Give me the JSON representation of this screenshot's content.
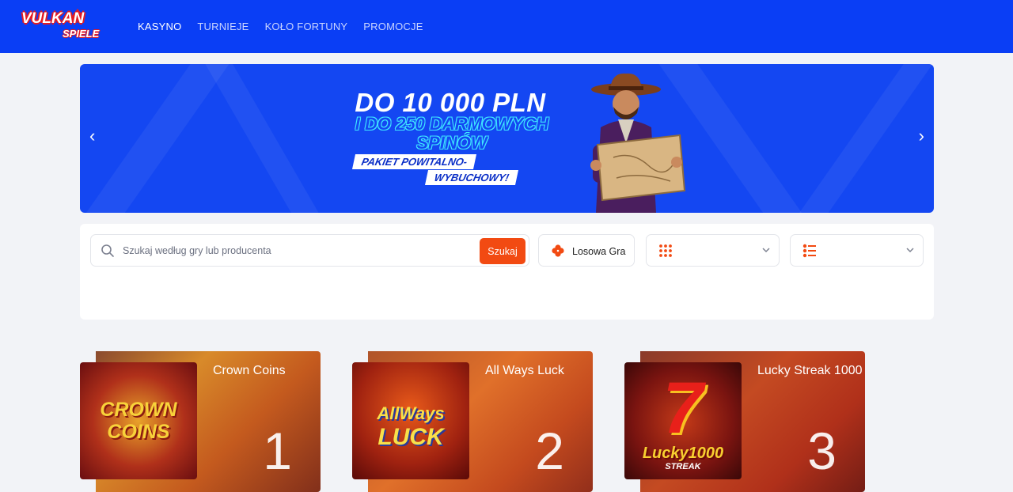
{
  "header": {
    "logo_main": "VULKAN",
    "logo_sub": "SPIELE",
    "nav": [
      {
        "label": "KASYNO",
        "active": true
      },
      {
        "label": "TURNIEJE",
        "active": false
      },
      {
        "label": "KOŁO FORTUNY",
        "active": false
      },
      {
        "label": "PROMOCJE",
        "active": false
      }
    ]
  },
  "banner": {
    "headline": "DO 10 000 PLN",
    "subline1": "I DO 250 DARMOWYCH",
    "subline2": "SPINÓW",
    "tag1": "PAKIET POWITALNO-",
    "tag2": "WYBUCHOWY!",
    "prev": "‹",
    "next": "›",
    "icon_prev": "chevron-left-icon",
    "icon_next": "chevron-right-icon"
  },
  "search": {
    "placeholder": "Szukaj według gry lub producenta",
    "value": "",
    "button": "Szukaj",
    "random_label": "Losowa Gra"
  },
  "filters": {
    "categories_icon": "grid-dots-icon",
    "providers_icon": "list-icon"
  },
  "games": [
    {
      "title": "Crown Coins",
      "rank": "1",
      "thumb_line1": "CROWN",
      "thumb_line2": "COINS"
    },
    {
      "title": "All Ways Luck",
      "rank": "2",
      "thumb_line1": "AllWays",
      "thumb_line2": "LUCK"
    },
    {
      "title": "Lucky Streak 1000",
      "rank": "3",
      "thumb_line1": "7",
      "thumb_line2": "Lucky1000",
      "thumb_line3": "STREAK"
    }
  ],
  "colors": {
    "header_bg": "#0a3ef5",
    "accent": "#f24a12",
    "page_bg": "#f2f3f7"
  }
}
